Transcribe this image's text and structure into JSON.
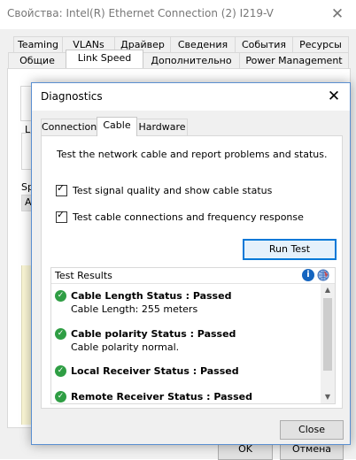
{
  "back_window": {
    "title": "Свойства: Intel(R) Ethernet Connection (2) I219-V",
    "close_glyph": "✕",
    "tabs_row1": [
      "Teaming",
      "VLANs",
      "Драйвер",
      "Сведения",
      "События",
      "Ресурсы"
    ],
    "tabs_row2": [
      "Общие",
      "Link Speed",
      "Дополнительно",
      "Power Management"
    ],
    "active_tab": "Link Speed",
    "fragment_l": "L",
    "fragment_sp": "Sp",
    "fragment_a": "A",
    "ok_label": "OK",
    "cancel_label": "Отмена"
  },
  "dialog": {
    "title": "Diagnostics",
    "close_glyph": "✕",
    "tabs": [
      "Connection",
      "Cable",
      "Hardware"
    ],
    "active_tab": "Cable",
    "description": "Test the network cable and report problems and status.",
    "checkbox_signal": {
      "label": "Test signal quality and show cable status",
      "checked": true
    },
    "checkbox_connections": {
      "label": "Test cable connections and frequency response",
      "checked": true
    },
    "run_test_label": "Run Test",
    "results_label": "Test Results",
    "results": [
      {
        "title": "Cable Length Status : Passed",
        "detail": "Cable Length: 255 meters"
      },
      {
        "title": "Cable polarity Status : Passed",
        "detail": "Cable polarity normal."
      },
      {
        "title": "Local Receiver Status : Passed",
        "detail": ""
      },
      {
        "title": "Remote Receiver Status : Passed",
        "detail": ""
      }
    ],
    "close_label": "Close"
  },
  "icons": {
    "check": "✓",
    "ok": "✓",
    "info": "i",
    "scroll_up": "▲",
    "scroll_down": "▼"
  },
  "colors": {
    "accent": "#0078d7",
    "pass": "#2f9e44",
    "info": "#1565c0"
  }
}
